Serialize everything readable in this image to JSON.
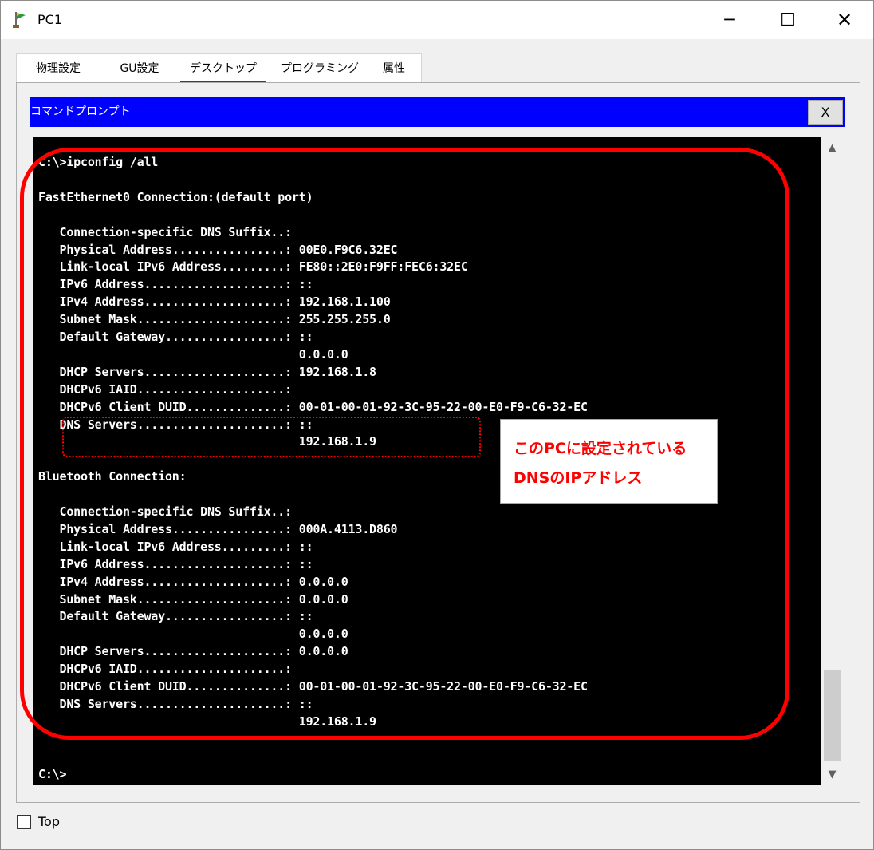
{
  "window": {
    "title": "PC1",
    "icon": "network-pc-icon",
    "minimize": "─",
    "maximize": "☐",
    "close": "✕"
  },
  "tabs": [
    {
      "label": "物理設定",
      "active": false
    },
    {
      "label": "GU設定",
      "active": false
    },
    {
      "label": "デスクトップ",
      "active": true
    },
    {
      "label": "プログラミング",
      "active": false
    },
    {
      "label": "属性",
      "active": false
    }
  ],
  "command_prompt": {
    "title": "コマンドプロンプト",
    "close_label": "X",
    "lines": [
      "C:\\>ipconfig /all",
      "",
      "FastEthernet0 Connection:(default port)",
      "",
      "   Connection-specific DNS Suffix..:",
      "   Physical Address................: 00E0.F9C6.32EC",
      "   Link-local IPv6 Address.........: FE80::2E0:F9FF:FEC6:32EC",
      "   IPv6 Address....................: ::",
      "   IPv4 Address....................: 192.168.1.100",
      "   Subnet Mask.....................: 255.255.255.0",
      "   Default Gateway.................: ::",
      "                                     0.0.0.0",
      "   DHCP Servers....................: 192.168.1.8",
      "   DHCPv6 IAID.....................:",
      "   DHCPv6 Client DUID..............: 00-01-00-01-92-3C-95-22-00-E0-F9-C6-32-EC",
      "   DNS Servers.....................: ::",
      "                                     192.168.1.9",
      "",
      "Bluetooth Connection:",
      "",
      "   Connection-specific DNS Suffix..:",
      "   Physical Address................: 000A.4113.D860",
      "   Link-local IPv6 Address.........: ::",
      "   IPv6 Address....................: ::",
      "   IPv4 Address....................: 0.0.0.0",
      "   Subnet Mask.....................: 0.0.0.0",
      "   Default Gateway.................: ::",
      "                                     0.0.0.0",
      "   DHCP Servers....................: 0.0.0.0",
      "   DHCPv6 IAID.....................:",
      "   DHCPv6 Client DUID..............: 00-01-00-01-92-3C-95-22-00-E0-F9-C6-32-EC",
      "   DNS Servers.....................: ::",
      "                                     192.168.1.9",
      "",
      "",
      "C:\\>"
    ]
  },
  "annotation": {
    "line1": "このPCに設定されている",
    "line2": "DNSのIPアドレス",
    "color": "#ff0000"
  },
  "footer": {
    "top_label": "Top",
    "top_checked": false
  },
  "colors": {
    "cmd_title_bg": "#0000ff",
    "terminal_bg": "#000000",
    "terminal_fg": "#ffffff",
    "active_tab_underline": "#2d3f6b"
  }
}
